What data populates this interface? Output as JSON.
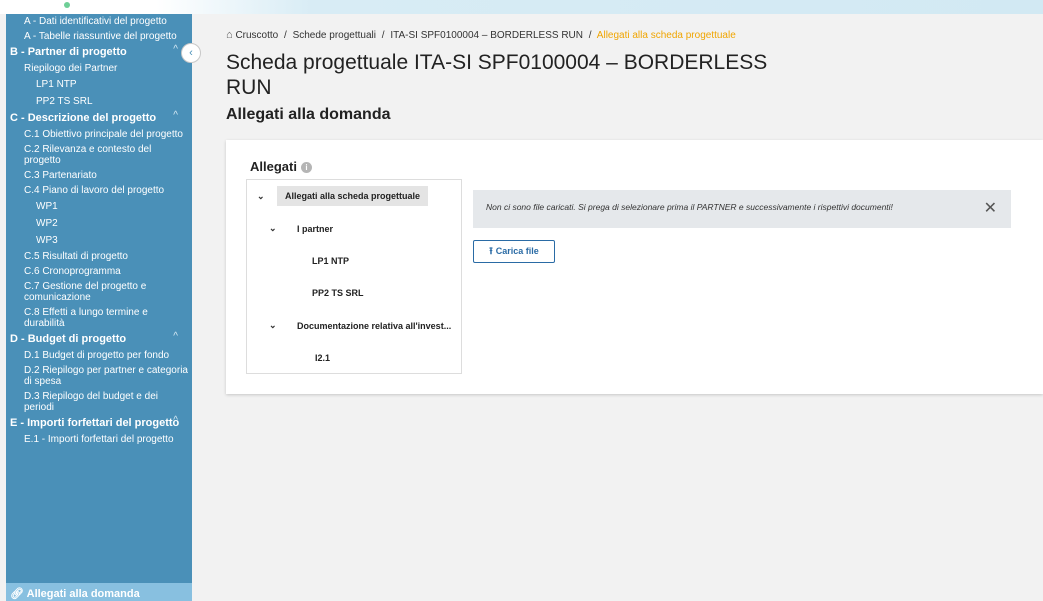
{
  "sidebar": {
    "collapse_icon": "chevron-left-icon",
    "rows": [
      {
        "kind": "item",
        "label": "A - Dati identificativi del progetto"
      },
      {
        "kind": "item",
        "label": "A - Tabelle riassuntive del progetto"
      },
      {
        "kind": "section",
        "label": "B - Partner di progetto",
        "chevron": "^"
      },
      {
        "kind": "item",
        "label": "Riepilogo dei Partner"
      },
      {
        "kind": "sub",
        "label": "LP1 NTP"
      },
      {
        "kind": "sub",
        "label": "PP2 TS SRL"
      },
      {
        "kind": "section",
        "label": "C - Descrizione del progetto",
        "chevron": "^"
      },
      {
        "kind": "item",
        "label": "C.1 Obiettivo principale del progetto"
      },
      {
        "kind": "item",
        "label": "C.2 Rilevanza e contesto del progetto"
      },
      {
        "kind": "item",
        "label": "C.3 Partenariato"
      },
      {
        "kind": "item",
        "label": "C.4 Piano di lavoro del progetto"
      },
      {
        "kind": "sub",
        "label": "WP1"
      },
      {
        "kind": "sub",
        "label": "WP2"
      },
      {
        "kind": "sub",
        "label": "WP3"
      },
      {
        "kind": "item",
        "label": "C.5 Risultati di progetto"
      },
      {
        "kind": "item",
        "label": "C.6 Cronoprogramma"
      },
      {
        "kind": "item",
        "label": "C.7 Gestione del progetto e comunicazione"
      },
      {
        "kind": "item",
        "label": "C.8 Effetti a lungo termine e durabilità"
      },
      {
        "kind": "section",
        "label": "D - Budget di progetto",
        "chevron": "^"
      },
      {
        "kind": "item",
        "label": "D.1 Budget di progetto per fondo"
      },
      {
        "kind": "item",
        "label": "D.2 Riepilogo per partner e categoria di spesa"
      },
      {
        "kind": "item",
        "label": "D.3 Riepilogo del budget e dei periodi"
      },
      {
        "kind": "section",
        "label": "E - Importi forfettari del progetto",
        "chevron": "^"
      },
      {
        "kind": "item",
        "label": "E.1 - Importi forfettari del progetto"
      }
    ],
    "active_label": "Allegati alla domanda",
    "active_icon": "attachment-icon"
  },
  "breadcrumb": {
    "home_icon": "home-icon",
    "items": [
      "Cruscotto",
      "Schede progettuali",
      "ITA-SI SPF0100004 – BORDERLESS RUN"
    ],
    "current": "Allegati alla scheda progettuale",
    "separator": "/",
    "current_color": "#f0a500"
  },
  "page": {
    "title": "Scheda progettuale ITA-SI SPF0100004 – BORDERLESS RUN",
    "subtitle": "Allegati alla domanda"
  },
  "allegati": {
    "title": "Allegati",
    "info_icon": "info-icon",
    "tree": [
      {
        "label": "Allegati alla scheda progettuale",
        "chevron": "⌄",
        "selected": true
      },
      {
        "label": "I partner",
        "chevron": "⌄",
        "selected": false
      },
      {
        "label": "LP1 NTP",
        "chevron": "",
        "selected": false
      },
      {
        "label": "PP2 TS SRL",
        "chevron": "",
        "selected": false
      },
      {
        "label": "Documentazione relativa all'invest...",
        "chevron": "⌄",
        "selected": false
      },
      {
        "label": "I2.1",
        "chevron": "",
        "selected": false
      }
    ],
    "alert_message": "Non ci sono file caricati. Si prega di selezionare prima il PARTNER e successivamente i rispettivi documenti!",
    "close_glyph": "✕",
    "upload_label": "Carica file",
    "upload_icon": "upload-icon"
  },
  "colors": {
    "sidebar_bg": "#4a90b8",
    "sidebar_active_bg": "#88c0e0",
    "primary": "#2a6ba5",
    "breadcrumb_current": "#f0a500"
  }
}
